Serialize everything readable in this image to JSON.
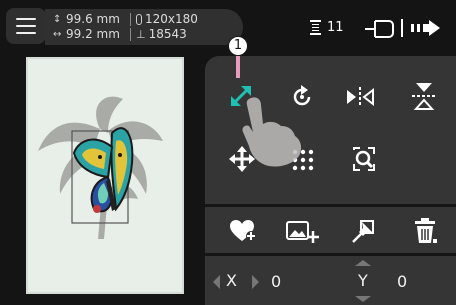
{
  "status_bar": {
    "height_value": "99.6 mm",
    "width_value": "99.2 mm",
    "hoop_size": "120x180",
    "stitch_count": "18543",
    "thread_changes": "11"
  },
  "edit_panel": {
    "tools": [
      "resize-tool",
      "rotate-tool",
      "mirror-horizontal-tool",
      "mirror-vertical-tool",
      "move-tool",
      "point-grid-tool",
      "zoom-tool"
    ],
    "actions": [
      "add-to-favorites",
      "add-image",
      "pin",
      "delete"
    ]
  },
  "coordinates": {
    "x_label": "X",
    "x_value": "0",
    "y_label": "Y",
    "y_value": "0"
  },
  "callout": {
    "number": "1"
  },
  "colors": {
    "accent_teal": "#1ec0b2",
    "panel_bg": "#353535",
    "background": "#141414",
    "callout_line": "#e79bbd"
  }
}
